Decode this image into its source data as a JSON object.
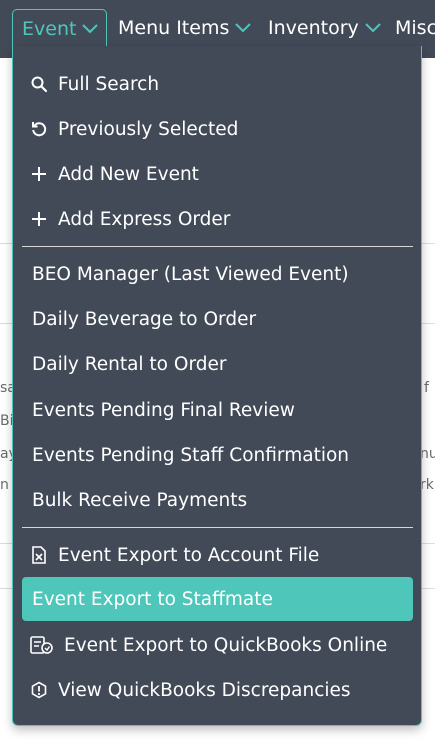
{
  "nav": {
    "event": "Event",
    "menu_items": "Menu Items",
    "inventory": "Inventory",
    "misc": "Misc"
  },
  "background_fragments": [
    "sa",
    "f",
    "Bi",
    "ay",
    "nu",
    "n E",
    "rk"
  ],
  "menu": {
    "full_search": "Full Search",
    "previously_selected": "Previously Selected",
    "add_new_event": "Add New Event",
    "add_express_order": "Add Express Order",
    "beo_manager": "BEO Manager (Last Viewed Event)",
    "daily_beverage": "Daily Beverage to Order",
    "daily_rental": "Daily Rental to Order",
    "pending_final_review": "Events Pending Final Review",
    "pending_staff_confirmation": "Events Pending Staff Confirmation",
    "bulk_receive_payments": "Bulk Receive Payments",
    "export_account_file": "Event Export to Account File",
    "export_staffmate": "Event Export to Staffmate",
    "export_quickbooks": "Event Export to QuickBooks Online",
    "view_qb_discrepancies": "View QuickBooks Discrepancies"
  },
  "colors": {
    "navbar_bg": "#424a58",
    "accent": "#4ec6b9",
    "menu_text": "#ffffff"
  },
  "icons": {
    "full_search": "search-icon",
    "previously_selected": "history-icon",
    "add_new_event": "plus-icon",
    "add_express_order": "plus-icon",
    "export_account_file": "excel-file-icon",
    "export_quickbooks": "invoice-sync-icon",
    "view_qb_discrepancies": "alert-circle-icon"
  }
}
